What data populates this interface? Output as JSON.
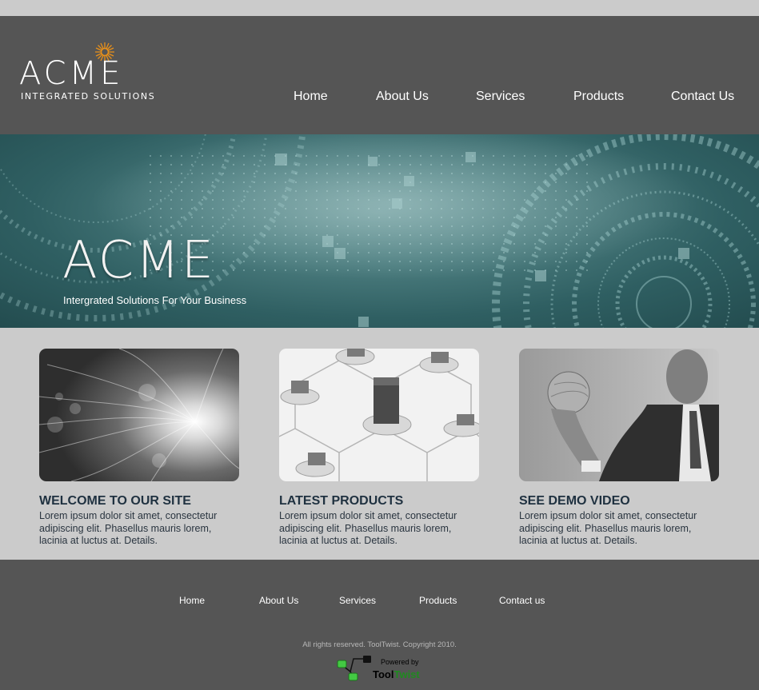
{
  "header": {
    "logo": {
      "word": "ACME",
      "subtitle": "INTEGRATED SOLUTIONS"
    },
    "nav": [
      "Home",
      "About Us",
      "Services",
      "Products",
      "Contact Us"
    ]
  },
  "hero": {
    "title": "ACME",
    "subtitle": "Intergrated Solutions For Your Business"
  },
  "cards": [
    {
      "title": "WELCOME TO OUR SITE",
      "text": "Lorem ipsum dolor sit amet, consectetur adipiscing elit. Phasellus mauris lorem, lacinia at luctus at. Details."
    },
    {
      "title": "LATEST PRODUCTS",
      "text": "Lorem ipsum dolor sit amet, consectetur adipiscing elit. Phasellus mauris lorem, lacinia at luctus at. Details."
    },
    {
      "title": "SEE DEMO VIDEO",
      "text": "Lorem ipsum dolor sit amet, consectetur adipiscing elit. Phasellus mauris lorem, lacinia at luctus at. Details."
    }
  ],
  "footer": {
    "nav": [
      "Home",
      "About Us",
      "Services",
      "Products",
      "Contact us"
    ],
    "copyright": "All rights reserved. ToolTwist. Copyright 2010.",
    "powered_by": "Powered by",
    "brand_a": "Tool",
    "brand_b": "Twist"
  },
  "colors": {
    "header_bg": "#555555",
    "page_bg": "#cbcbcb",
    "hero_teal": "#2f5f62",
    "card_title": "#1f3140",
    "logo_star": "#e8901a",
    "brand_green": "#1f8a1f"
  },
  "icons": [
    "sun-star-icon",
    "tooltwist-logo-icon"
  ]
}
